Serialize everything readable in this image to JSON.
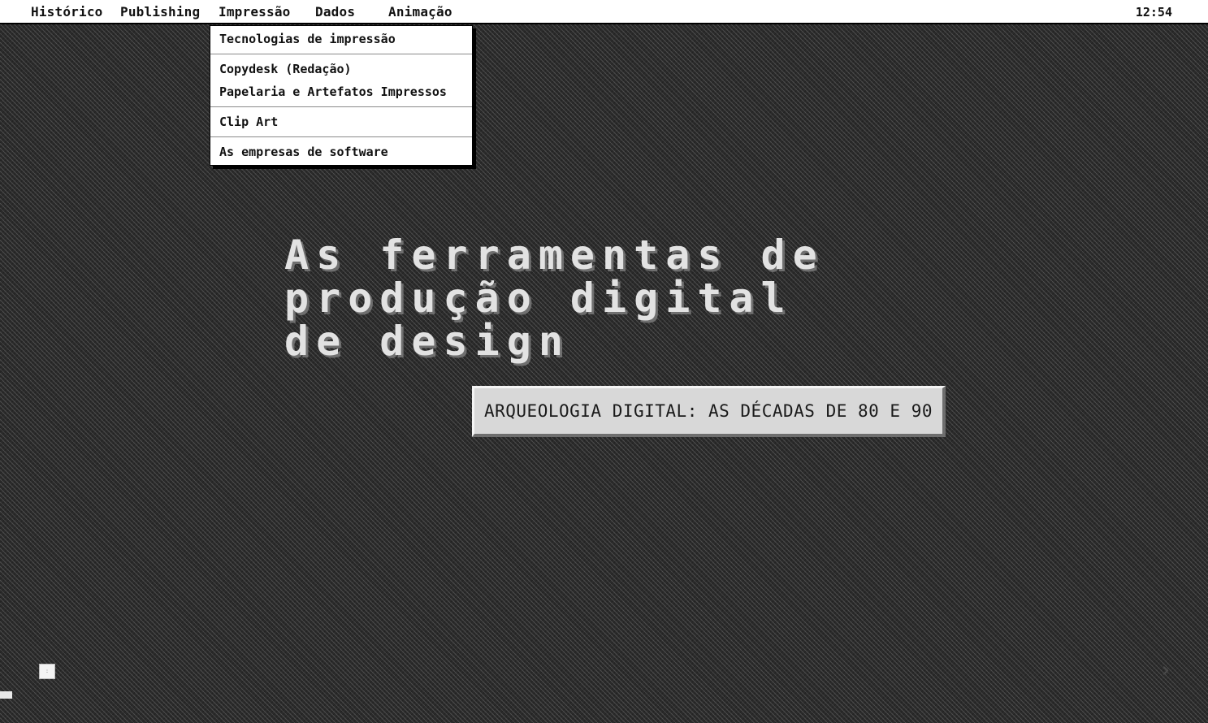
{
  "menubar": {
    "items": [
      {
        "label": "Histórico"
      },
      {
        "label": "Publishing"
      },
      {
        "label": "Impressão"
      },
      {
        "label": "Dados"
      },
      {
        "label": "Animação"
      }
    ],
    "clock": "12:54"
  },
  "dropdown": {
    "items": [
      {
        "label": "Tecnologias de impressão"
      },
      {
        "label": "Copydesk (Redação)"
      },
      {
        "label": "Papelaria e Artefatos Impressos"
      },
      {
        "label": "Clip Art"
      },
      {
        "label": "As empresas de software"
      }
    ]
  },
  "hero": {
    "lines": [
      "As ferramentas de",
      "produção digital",
      "de design"
    ]
  },
  "plaque": {
    "label": "ARQUEOLOGIA DIGITAL: AS DÉCADAS DE 80 E 90"
  },
  "controls": {
    "next_icon": "chevron-right-icon",
    "next_glyph": "›"
  }
}
